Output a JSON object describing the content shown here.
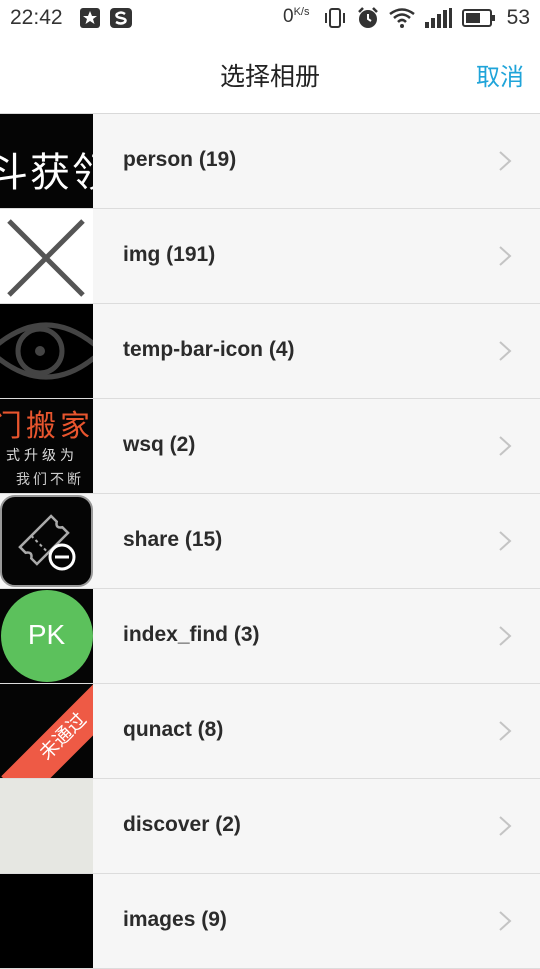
{
  "status_bar": {
    "time": "22:42",
    "network_speed": "0",
    "network_unit": "K/s",
    "battery": "53",
    "icons": [
      "star-app-icon",
      "s-app-icon",
      "vibrate-icon",
      "alarm-icon",
      "wifi-icon",
      "signal-icon",
      "battery-icon"
    ]
  },
  "header": {
    "title": "选择相册",
    "cancel_label": "取消"
  },
  "albums": [
    {
      "label": "person (19)",
      "thumb": "person"
    },
    {
      "label": "img (191)",
      "thumb": "img"
    },
    {
      "label": "temp-bar-icon (4)",
      "thumb": "eye"
    },
    {
      "label": "wsq (2)",
      "thumb": "wsq"
    },
    {
      "label": "share (15)",
      "thumb": "share"
    },
    {
      "label": "index_find (3)",
      "thumb": "pk"
    },
    {
      "label": "qunact (8)",
      "thumb": "qunact"
    },
    {
      "label": "discover (2)",
      "thumb": "discover"
    },
    {
      "label": "images (9)",
      "thumb": "images"
    }
  ],
  "thumb_text": {
    "person": "斗获领",
    "wsq_line1": "门搬家",
    "wsq_line2": "式升级为",
    "wsq_line3": "我们不断",
    "pk": "PK",
    "qunact": "未通过"
  },
  "colors": {
    "accent": "#1fa4d9",
    "pk_green": "#5cc15c",
    "ribbon_red": "#ee5a45",
    "wsq_orange": "#e8552e"
  }
}
